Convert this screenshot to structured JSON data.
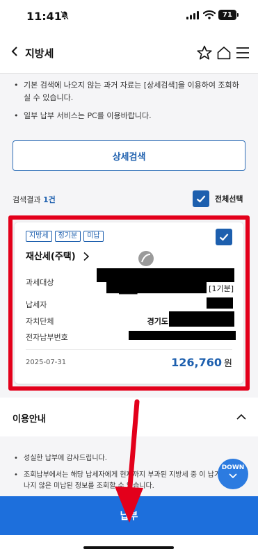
{
  "status_bar": {
    "time": "11:41",
    "battery": "71"
  },
  "header": {
    "title": "지방세"
  },
  "notices": [
    "기본 검색에 나오지 않는 과거 자료는 [상세검색]을 이용하여 조회하실 수 있습니다.",
    "일부 납부 서비스는 PC를 이용바랍니다."
  ],
  "detail_search_label": "상세검색",
  "results": {
    "label": "검색결과",
    "count": "1건",
    "select_all_label": "전체선택"
  },
  "card": {
    "tags": [
      "지방세",
      "정기분",
      "미납"
    ],
    "tax_name": "재산세(주택)",
    "watermark": "윤",
    "rows": [
      {
        "label": "과세대상",
        "value": "[1기분]"
      },
      {
        "label": "납세자",
        "value": ""
      },
      {
        "label": "자치단체",
        "value": "경기도"
      },
      {
        "label": "전자납부번호",
        "value": ""
      }
    ],
    "due_date": "2025-07-31",
    "amount": "126,760",
    "amount_unit": "원"
  },
  "guide": {
    "title": "이용안내",
    "items": [
      "성실한 납부에 감사드립니다.",
      "조회납부에서는 해당 납세자에게 현재까지 부과된 지방세 중 이 납기일이 지나지 않은 미납된 정보를 조회할 수 있습니다."
    ]
  },
  "down_label": "DOWN",
  "pay_button_label": "납부",
  "colors": {
    "accent": "#1d5fae",
    "pay_button": "#1d6fdc",
    "highlight": "#e3001b"
  }
}
